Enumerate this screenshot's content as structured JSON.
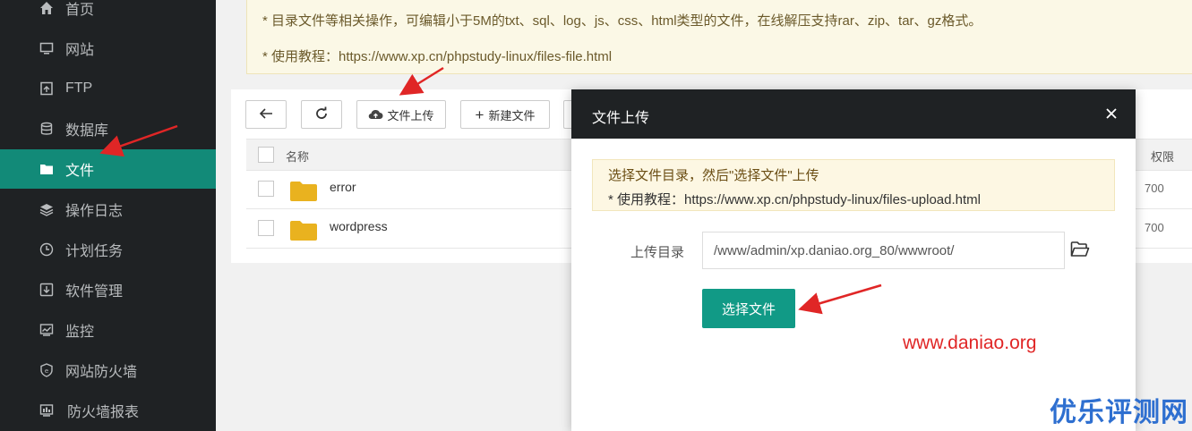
{
  "sidebar": {
    "items": [
      {
        "label": "首页",
        "icon": "home-icon"
      },
      {
        "label": "网站",
        "icon": "monitor-icon"
      },
      {
        "label": "FTP",
        "icon": "ftp-icon"
      },
      {
        "label": "数据库",
        "icon": "database-icon"
      },
      {
        "label": "文件",
        "icon": "folder-icon",
        "active": true
      },
      {
        "label": "操作日志",
        "icon": "layers-icon"
      },
      {
        "label": "计划任务",
        "icon": "clock-icon"
      },
      {
        "label": "软件管理",
        "icon": "download-icon"
      },
      {
        "label": "监控",
        "icon": "chart-icon"
      },
      {
        "label": "网站防火墙",
        "icon": "shield-icon"
      },
      {
        "label": "防火墙报表",
        "icon": "report-icon"
      }
    ]
  },
  "notice": {
    "line1": "* 目录文件等相关操作，可编辑小于5M的txt、sql、log、js、css、html类型的文件，在线解压支持rar、zip、tar、gz格式。",
    "line2": "* 使用教程：https://www.xp.cn/phpstudy-linux/files-file.html"
  },
  "toolbar": {
    "upload_label": "文件上传",
    "new_file_label": "新建文件"
  },
  "table": {
    "header_name": "名称",
    "header_perm": "权限",
    "rows": [
      {
        "name": "error",
        "perm": "700"
      },
      {
        "name": "wordpress",
        "perm": "700"
      }
    ]
  },
  "modal": {
    "title": "文件上传",
    "tip_line1": "选择文件目录，然后\"选择文件\"上传",
    "tip_line2": "* 使用教程：https://www.xp.cn/phpstudy-linux/files-upload.html",
    "dir_label": "上传目录",
    "dir_value": "/www/admin/xp.daniao.org_80/wwwroot/",
    "choose_button": "选择文件"
  },
  "watermarks": {
    "site": "www.daniao.org",
    "brand": "优乐评测网"
  },
  "colors": {
    "sidebar_bg": "#1f2224",
    "accent": "#128a78",
    "arrow": "#e02626"
  }
}
